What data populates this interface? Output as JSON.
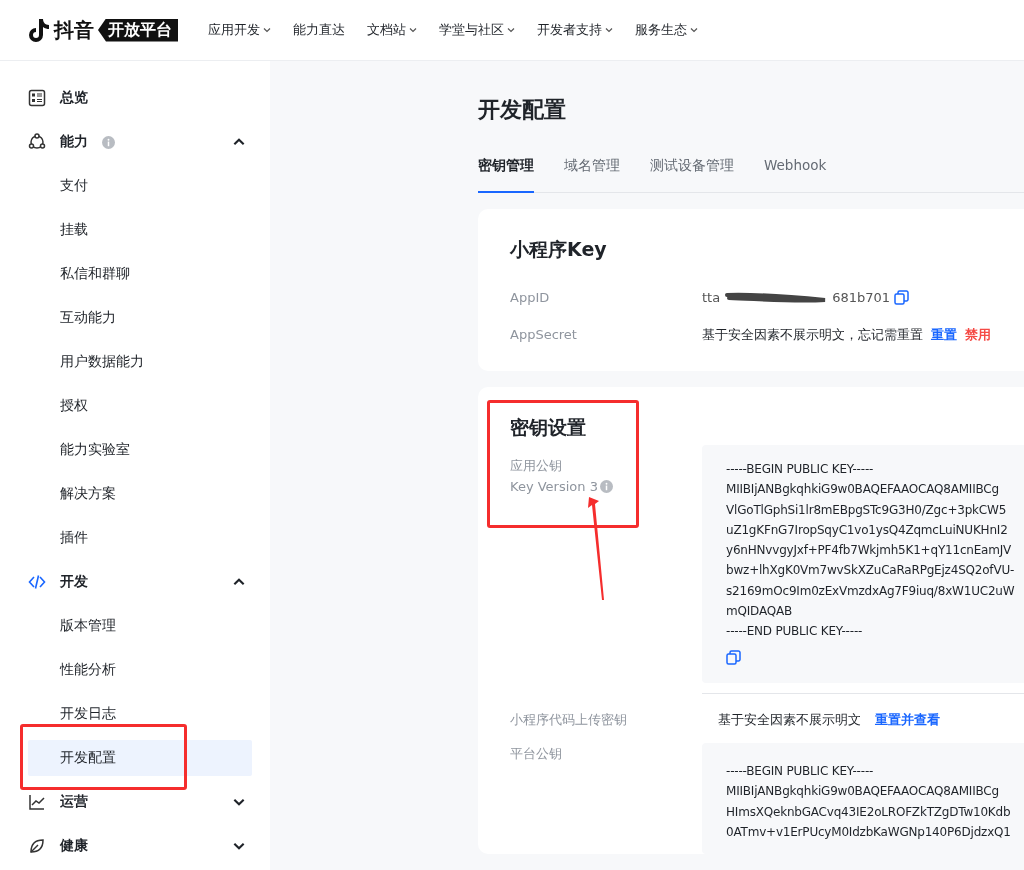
{
  "header": {
    "logo_text": "抖音",
    "logo_badge": "开放平台",
    "nav": [
      {
        "label": "应用开发",
        "dropdown": true
      },
      {
        "label": "能力直达",
        "dropdown": false
      },
      {
        "label": "文档站",
        "dropdown": true
      },
      {
        "label": "学堂与社区",
        "dropdown": true
      },
      {
        "label": "开发者支持",
        "dropdown": true
      },
      {
        "label": "服务生态",
        "dropdown": true
      }
    ]
  },
  "sidebar": {
    "items": [
      {
        "label": "总览",
        "kind": "overview"
      },
      {
        "label": "能力",
        "kind": "ability",
        "info": true,
        "expanded": true,
        "children": [
          {
            "label": "支付",
            "selected": false
          },
          {
            "label": "挂载",
            "selected": false
          },
          {
            "label": "私信和群聊",
            "selected": false
          },
          {
            "label": "互动能力",
            "selected": false
          },
          {
            "label": "用户数据能力",
            "selected": false
          },
          {
            "label": "授权",
            "selected": false
          },
          {
            "label": "能力实验室",
            "selected": false
          },
          {
            "label": "解决方案",
            "selected": false
          },
          {
            "label": "插件",
            "selected": false
          }
        ]
      },
      {
        "label": "开发",
        "kind": "code",
        "expanded": true,
        "children": [
          {
            "label": "版本管理",
            "selected": false
          },
          {
            "label": "性能分析",
            "selected": false
          },
          {
            "label": "开发日志",
            "selected": false
          },
          {
            "label": "开发配置",
            "selected": true
          }
        ]
      },
      {
        "label": "运营",
        "kind": "chart",
        "expanded": false
      },
      {
        "label": "健康",
        "kind": "leaf",
        "expanded": false
      }
    ]
  },
  "page": {
    "title": "开发配置",
    "tabs": [
      {
        "label": "密钥管理",
        "selected": true
      },
      {
        "label": "域名管理",
        "selected": false
      },
      {
        "label": "测试设备管理",
        "selected": false
      },
      {
        "label": "Webhook",
        "selected": false
      }
    ]
  },
  "key_card": {
    "title": "小程序Key",
    "appid": {
      "label": "AppID",
      "prefix": "tta",
      "suffix": "681b701"
    },
    "appsecret": {
      "label": "AppSecret",
      "note": "基于安全因素不展示明文，忘记需重置",
      "actions": [
        {
          "label": "重置",
          "kind": "primary"
        },
        {
          "label": "禁用",
          "kind": "danger"
        }
      ]
    }
  },
  "secret_card": {
    "title": "密钥设置",
    "app_key": {
      "label": "应用公钥",
      "version": "Key Version 3",
      "lines": [
        "-----BEGIN PUBLIC KEY-----",
        "MIIBIjANBgkqhkiG9w0BAQEFAAOCAQ8AMIIBCg",
        "VlGoTlGphSi1lr8mEBpgSTc9G3H0/Zgc+3pkCW5",
        "uZ1gKFnG7IropSqyC1vo1ysQ4ZqmcLuiNUKHnI2",
        "y6nHNvvgyJxf+PF4fb7Wkjmh5K1+qY11cnEamJV",
        "bwz+lhXgK0Vm7wvSkXZuCaRaRPgEjz4SQ2ofVU-",
        "s2169mOc9Im0zExVmzdxAg7F9iuq/8xW1UC2uW",
        "mQIDAQAB",
        "-----END PUBLIC KEY-----"
      ]
    },
    "upload_key": {
      "label": "小程序代码上传密钥",
      "note": "基于安全因素不展示明文",
      "action": "重置并查看"
    },
    "platform_key": {
      "label": "平台公钥",
      "lines": [
        "-----BEGIN PUBLIC KEY-----",
        "MIIBIjANBgkqhkiG9w0BAQEFAAOCAQ8AMIIBCg",
        "HImsXQeknbGACvq43IE2oLROFZkTZgDTw10Kdb",
        "0ATmv+v1ErPUcyM0IdzbKaWGNp140P6DjdzxQ1"
      ]
    }
  },
  "annotations": [
    {
      "kind": "box"
    },
    {
      "kind": "box"
    },
    {
      "kind": "arrow"
    }
  ]
}
